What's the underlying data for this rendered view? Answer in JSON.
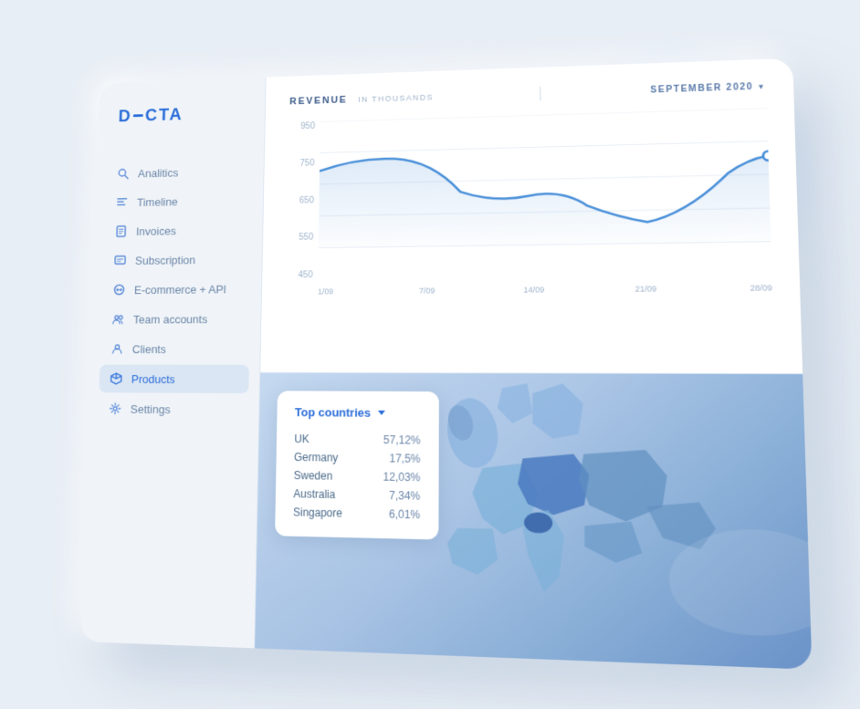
{
  "app": {
    "name": "DECTA"
  },
  "sidebar": {
    "nav_items": [
      {
        "id": "analytics",
        "label": "Analitics",
        "icon": "search",
        "active": false
      },
      {
        "id": "timeline",
        "label": "Timeline",
        "icon": "timeline",
        "active": false
      },
      {
        "id": "invoices",
        "label": "Invoices",
        "icon": "invoices",
        "active": false
      },
      {
        "id": "subscription",
        "label": "Subscription",
        "icon": "subscription",
        "active": false
      },
      {
        "id": "ecommerce",
        "label": "E-commerce + API",
        "icon": "ecommerce",
        "active": false
      },
      {
        "id": "team",
        "label": "Team accounts",
        "icon": "team",
        "active": false
      },
      {
        "id": "clients",
        "label": "Clients",
        "icon": "clients",
        "active": false
      },
      {
        "id": "products",
        "label": "Products",
        "icon": "products",
        "active": true
      },
      {
        "id": "settings",
        "label": "Settings",
        "icon": "settings",
        "active": false
      }
    ]
  },
  "revenue_chart": {
    "title": "REVENUE",
    "subtitle": "IN THOUSANDS",
    "period": "SEPTEMBER 2020",
    "period_selector": "▼",
    "y_labels": [
      "950",
      "750",
      "650",
      "550",
      "450"
    ],
    "x_labels": [
      "1/09",
      "7/09",
      "14/09",
      "21/09",
      "28/09"
    ],
    "line_color": "#4a90d9"
  },
  "map_panel": {
    "title": "Top countries",
    "countries": [
      {
        "name": "UK",
        "pct": "57,12%"
      },
      {
        "name": "Germany",
        "pct": "17,5%"
      },
      {
        "name": "Sweden",
        "pct": "12,03%"
      },
      {
        "name": "Australia",
        "pct": "7,34%"
      },
      {
        "name": "Singapore",
        "pct": "6,01%"
      }
    ]
  }
}
